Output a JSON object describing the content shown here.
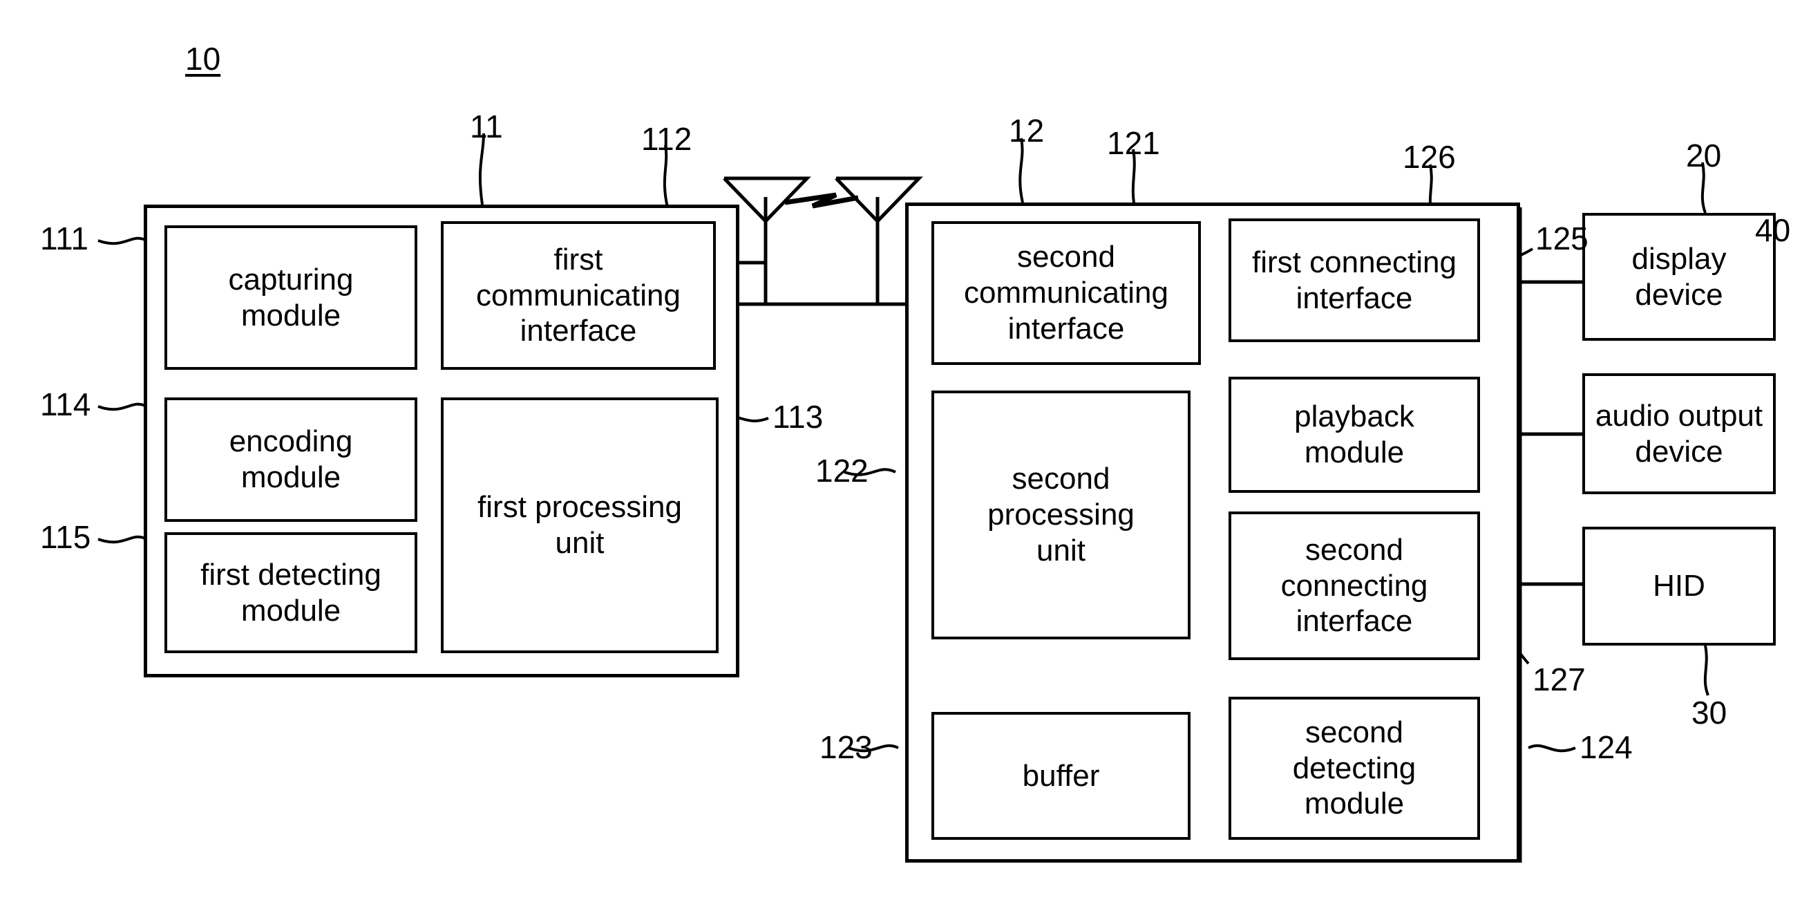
{
  "figure": {
    "system_label": "10"
  },
  "first_device": {
    "ref": "11",
    "modules": [
      {
        "id": "capturing-module",
        "label": "capturing\nmodule",
        "ref": "111"
      },
      {
        "id": "encoding-module",
        "label": "encoding\nmodule",
        "ref": "114"
      },
      {
        "id": "first-detecting-module",
        "label": "first detecting\nmodule",
        "ref": "115"
      },
      {
        "id": "first-communicating-interface",
        "label": "first\ncommunicating\ninterface",
        "ref": "112"
      },
      {
        "id": "first-processing-unit",
        "label": "first processing\nunit",
        "ref": "113"
      }
    ]
  },
  "second_device": {
    "ref": "12",
    "modules": [
      {
        "id": "second-communicating-interface",
        "label": "second\ncommunicating\ninterface",
        "ref": "121"
      },
      {
        "id": "second-processing-unit",
        "label": "second\nprocessing\nunit",
        "ref": "122"
      },
      {
        "id": "buffer",
        "label": "buffer",
        "ref": "123"
      },
      {
        "id": "second-detecting-module",
        "label": "second\ndetecting\nmodule",
        "ref": "124"
      },
      {
        "id": "first-connecting-interface",
        "label": "first connecting\ninterface",
        "ref": "126"
      },
      {
        "id": "playback-module",
        "label": "playback\nmodule",
        "ref": "125"
      },
      {
        "id": "second-connecting-interface",
        "label": "second\nconnecting\ninterface",
        "ref": "127"
      }
    ]
  },
  "peripherals": [
    {
      "id": "display-device",
      "label": "display\ndevice",
      "ref": "20"
    },
    {
      "id": "audio-output-device",
      "label": "audio output\ndevice",
      "ref": "40"
    },
    {
      "id": "hid",
      "label": "HID",
      "ref": "30"
    }
  ],
  "icons": {
    "antenna_left": "antenna-icon",
    "antenna_right": "antenna-icon",
    "wireless_link": "lightning-bolt-icon"
  },
  "colors": {
    "stroke": "#000000",
    "background": "#ffffff"
  }
}
